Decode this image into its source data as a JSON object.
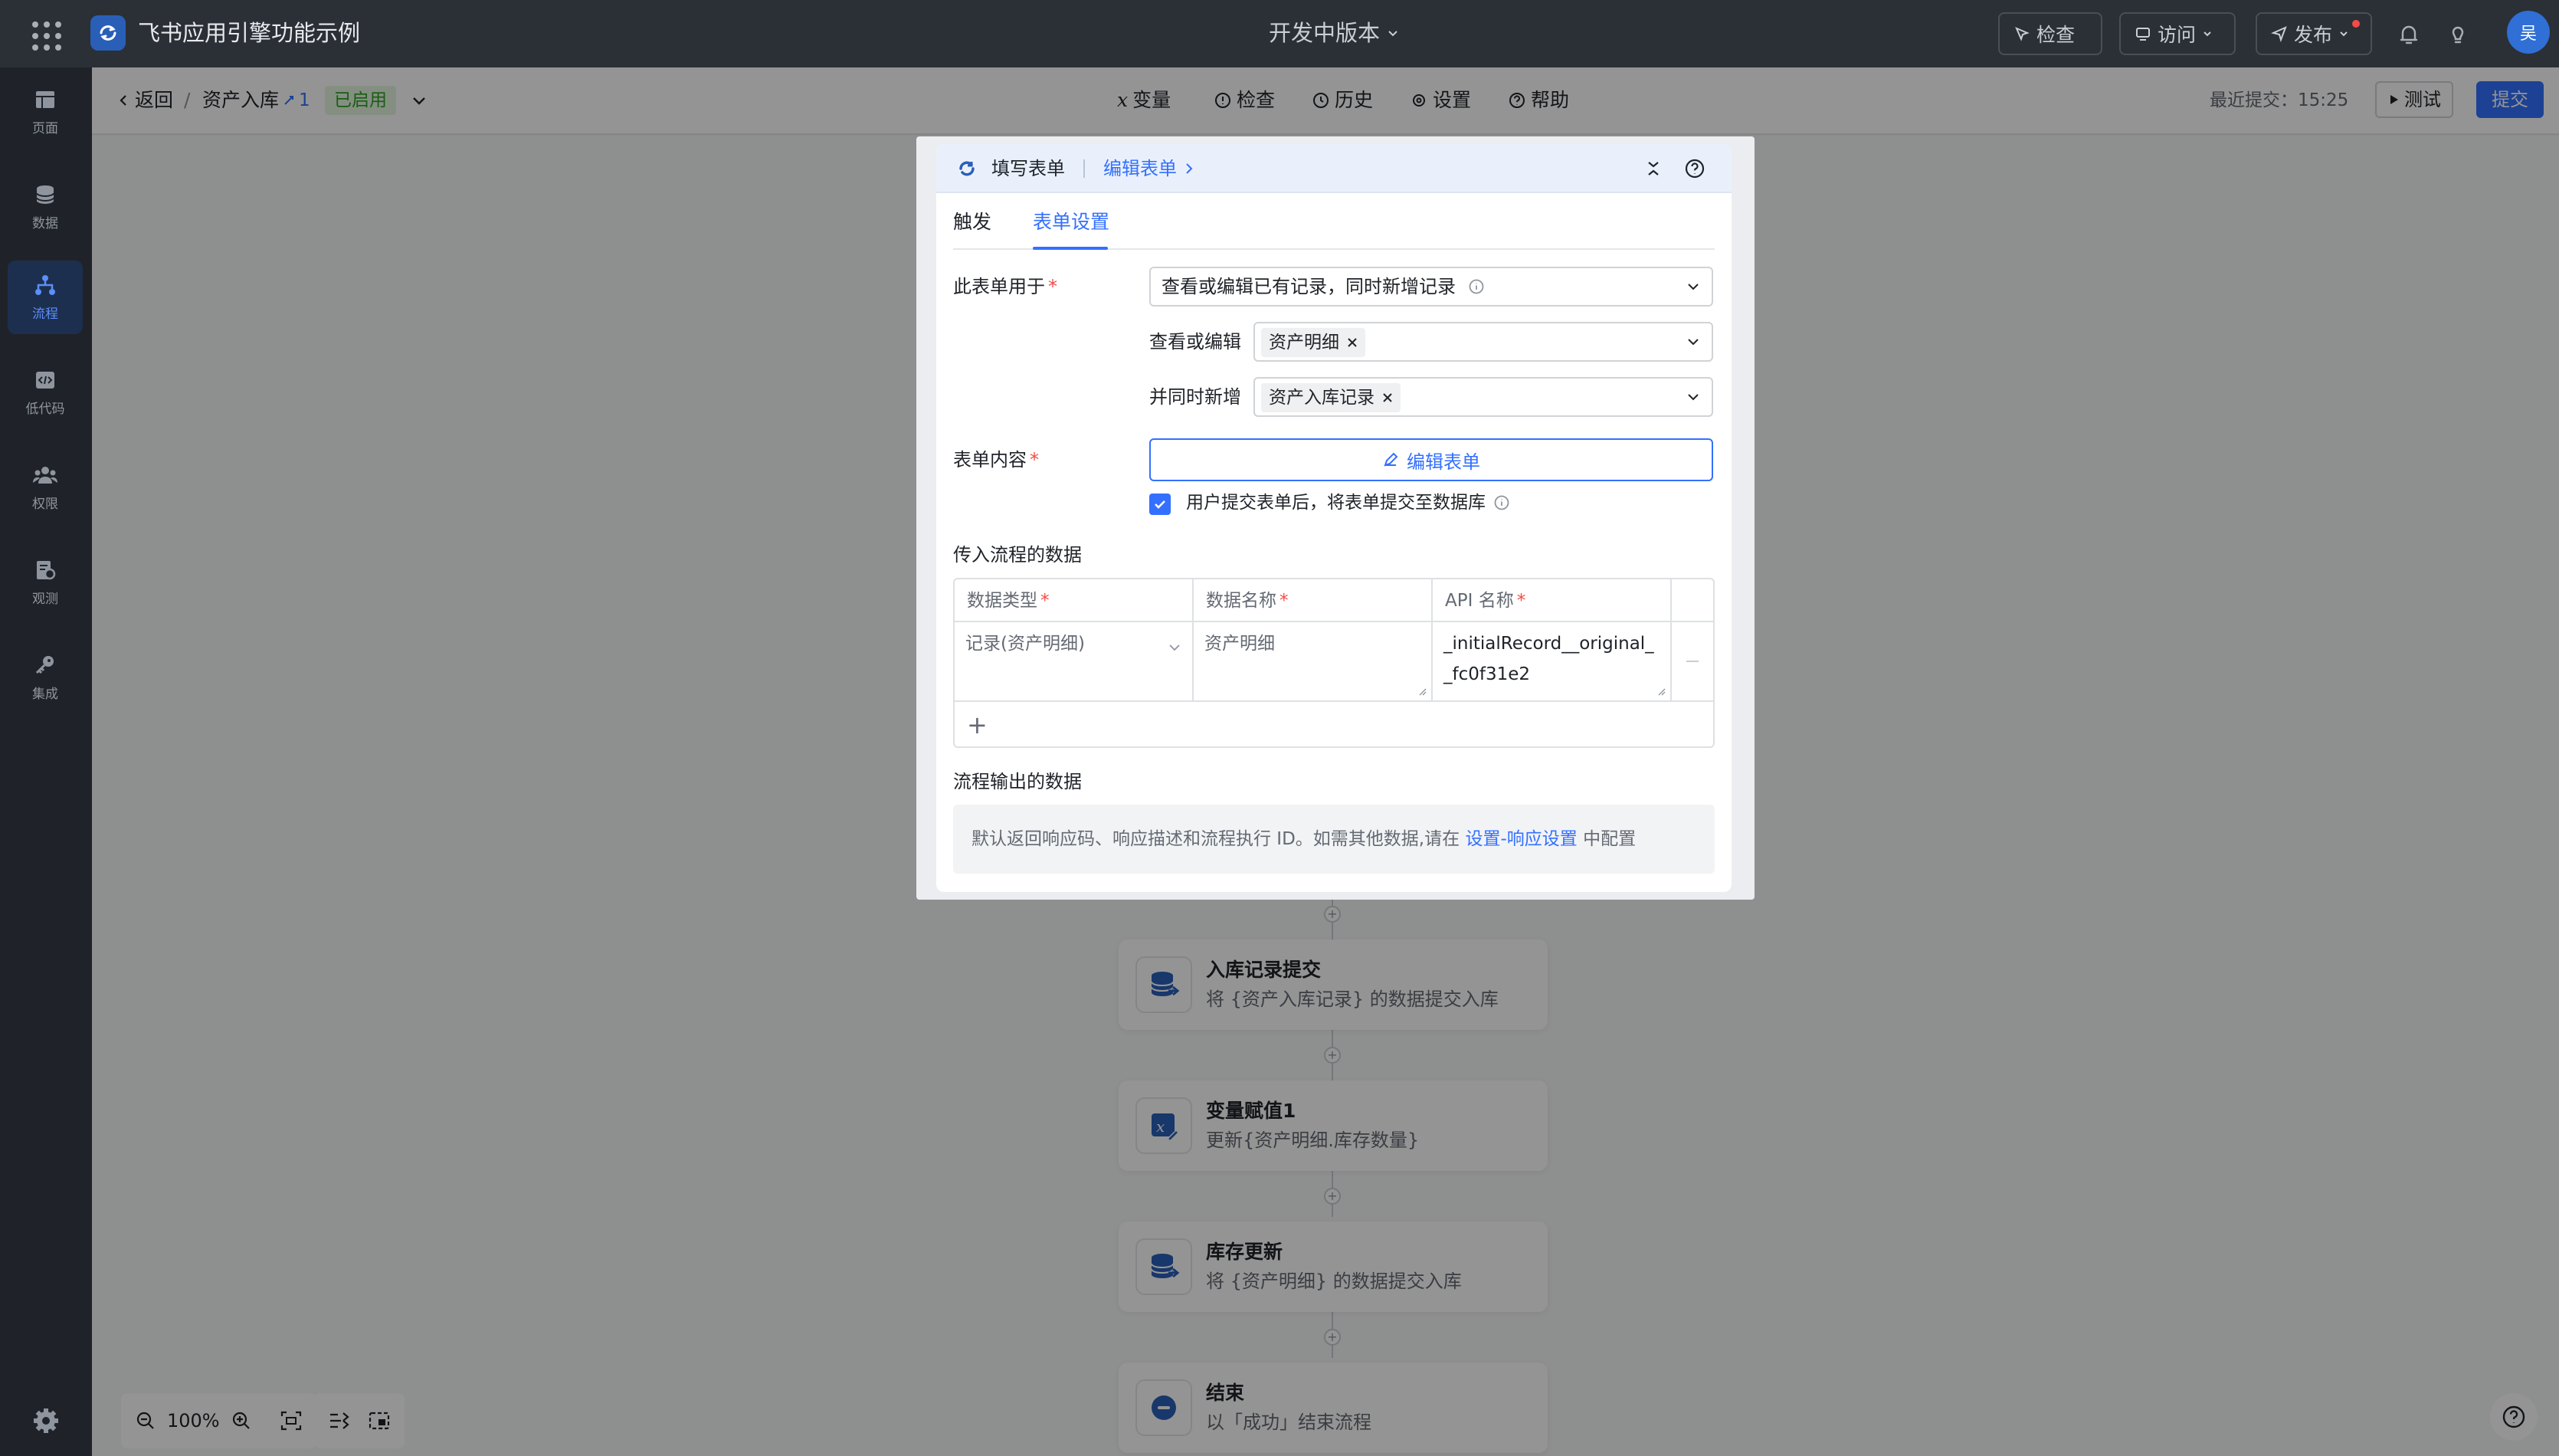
{
  "app": {
    "name": "飞书应用引擎功能示例",
    "version": "开发中版本",
    "buttons": {
      "inspect": "检查",
      "visit": "访问",
      "publish": "发布"
    },
    "avatar": "吴"
  },
  "sidebar": {
    "items": [
      {
        "label": "页面",
        "icon": "page-icon"
      },
      {
        "label": "数据",
        "icon": "database-icon"
      },
      {
        "label": "流程",
        "icon": "flow-icon",
        "active": true
      },
      {
        "label": "低代码",
        "icon": "code-icon"
      },
      {
        "label": "权限",
        "icon": "users-icon"
      },
      {
        "label": "观测",
        "icon": "monitor-icon"
      },
      {
        "label": "集成",
        "icon": "key-icon"
      }
    ]
  },
  "subbar": {
    "back": "返回",
    "flow_name": "资产入库",
    "version": "1",
    "status": "已启用",
    "tools": {
      "variables": "变量",
      "check": "检查",
      "history": "历史",
      "settings": "设置",
      "help": "帮助"
    },
    "recent_label": "最近提交：",
    "recent_time": "15:25",
    "test": "测试",
    "submit": "提交"
  },
  "flow_nodes": [
    {
      "title": "入库记录提交",
      "desc": "将 {资产入库记录} 的数据提交入库",
      "icon": "database-submit-icon"
    },
    {
      "title": "变量赋值1",
      "desc": "更新{资产明细.库存数量}",
      "icon": "variable-assign-icon"
    },
    {
      "title": "库存更新",
      "desc": "将 {资产明细} 的数据提交入库",
      "icon": "database-submit-icon"
    },
    {
      "title": "结束",
      "desc": "以「成功」结束流程",
      "icon": "end-icon"
    }
  ],
  "zoom": {
    "level": "100%"
  },
  "modal": {
    "title": "填写表单",
    "edit_link": "编辑表单",
    "tabs": [
      "触发",
      "表单设置"
    ],
    "active_tab": 1,
    "form_usage": {
      "label": "此表单用于",
      "value": "查看或编辑已有记录，同时新增记录",
      "view_edit_label": "查看或编辑",
      "view_edit_tag": "资产明细",
      "add_label": "并同时新增",
      "add_tag": "资产入库记录"
    },
    "form_content": {
      "label": "表单内容",
      "button": "编辑表单",
      "checkbox_label": "用户提交表单后，将表单提交至数据库",
      "checked": true
    },
    "input_data": {
      "title": "传入流程的数据",
      "columns": [
        "数据类型",
        "数据名称",
        "API 名称"
      ],
      "rows": [
        {
          "type": "记录(资产明细)",
          "name": "资产明细",
          "api": "_initialRecord__original__fc0f31e2"
        }
      ]
    },
    "output_data": {
      "title": "流程输出的数据",
      "text_before": "默认返回响应码、响应描述和流程执行 ID。如需其他数据,请在",
      "link": "设置-响应设置",
      "text_after": "中配置"
    }
  }
}
